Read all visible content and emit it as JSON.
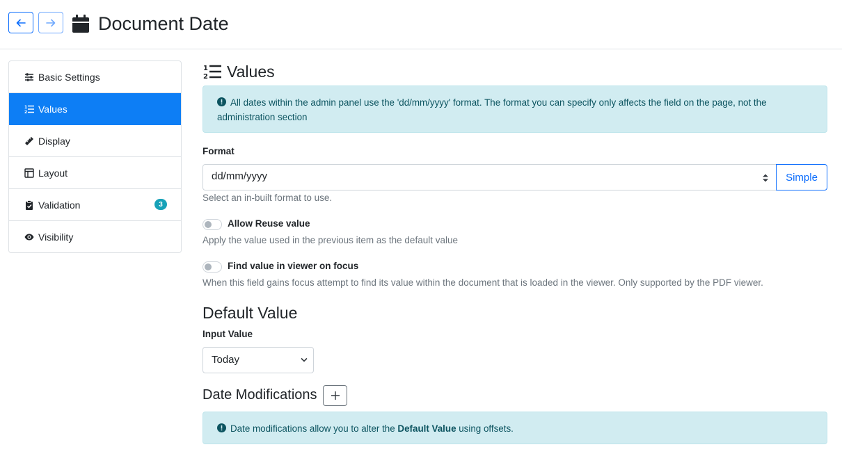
{
  "header": {
    "title": "Document Date",
    "back_icon": "arrow-left-icon",
    "forward_icon": "arrow-right-icon",
    "title_icon": "calendar-icon"
  },
  "sidebar": {
    "items": [
      {
        "label": "Basic Settings",
        "icon": "sliders-icon"
      },
      {
        "label": "Values",
        "icon": "list-ol-icon",
        "active": true
      },
      {
        "label": "Display",
        "icon": "ruler-icon"
      },
      {
        "label": "Layout",
        "icon": "layout-icon"
      },
      {
        "label": "Validation",
        "icon": "clipboard-check-icon",
        "badge": "3"
      },
      {
        "label": "Visibility",
        "icon": "eye-icon"
      }
    ]
  },
  "main": {
    "heading": "Values",
    "info_alert": "All dates within the admin panel use the 'dd/mm/yyyy' format. The format you can specify only affects the field on the page, not the administration section",
    "format": {
      "label": "Format",
      "value": "dd/mm/yyyy",
      "button": "Simple",
      "help": "Select an in-built format to use."
    },
    "reuse": {
      "label": "Allow Reuse value",
      "help": "Apply the value used in the previous item as the default value",
      "enabled": false
    },
    "find_value": {
      "label": "Find value in viewer on focus",
      "help": "When this field gains focus attempt to find its value within the document that is loaded in the viewer. Only supported by the PDF viewer.",
      "enabled": false
    },
    "default_value": {
      "heading": "Default Value",
      "input_label": "Input Value",
      "input_value": "Today"
    },
    "date_modifications": {
      "heading": "Date Modifications",
      "alert_prefix": "Date modifications allow you to alter the ",
      "alert_bold": "Default Value",
      "alert_suffix": " using offsets."
    }
  },
  "colors": {
    "primary": "#0d6efd",
    "active_bg": "#0d7ef5",
    "info_bg": "#d1ecf1",
    "info_text": "#0c5460",
    "badge": "#17a2b8"
  }
}
